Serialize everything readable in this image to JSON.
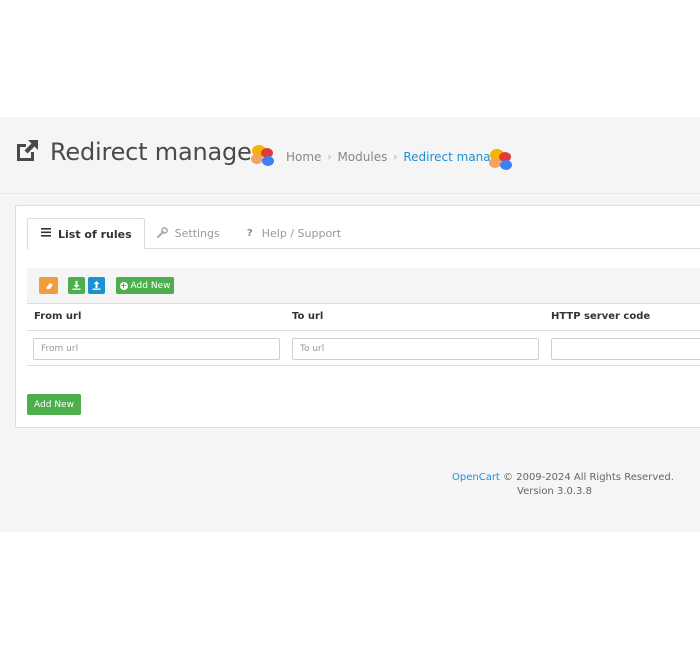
{
  "header": {
    "title": "Redirect manager",
    "external_link_icon": "external-link-icon",
    "logo_icon": "colored-dots-logo-icon",
    "breadcrumb": [
      {
        "label": "Home"
      },
      {
        "label": "Modules"
      },
      {
        "label": "Redirect manager"
      }
    ],
    "breadcrumb_separator": "›"
  },
  "tabs": [
    {
      "label": "List of rules",
      "icon": "list-icon",
      "active": true
    },
    {
      "label": "Settings",
      "icon": "wrench-icon",
      "active": false
    },
    {
      "label": "Help / Support",
      "icon": "question-icon",
      "active": false
    }
  ],
  "toolbar": {
    "eraser_icon": "eraser-icon",
    "download_icon": "download-icon",
    "upload_icon": "upload-icon",
    "add_new_label": "Add New"
  },
  "table": {
    "columns": [
      "From url",
      "To url",
      "HTTP server code"
    ],
    "row": {
      "from_placeholder": "From url",
      "to_placeholder": "To url",
      "code_value": ""
    }
  },
  "add_new_button": "Add New",
  "footer": {
    "link": "OpenCart",
    "copyright": " © 2009-2024 All Rights Reserved.",
    "version": "Version 3.0.3.8"
  },
  "colors": {
    "accent_blue": "#1e91cf",
    "green": "#4cae4c",
    "orange": "#f39c3c"
  }
}
